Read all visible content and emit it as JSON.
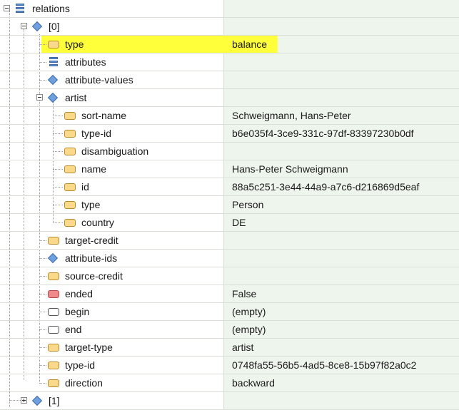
{
  "tree": {
    "rows": [
      {
        "label": "relations",
        "value": ""
      },
      {
        "label": "[0]",
        "value": ""
      },
      {
        "label": "type",
        "value": "balance"
      },
      {
        "label": "attributes",
        "value": ""
      },
      {
        "label": "attribute-values",
        "value": ""
      },
      {
        "label": "artist",
        "value": ""
      },
      {
        "label": "sort-name",
        "value": "Schweigmann, Hans-Peter"
      },
      {
        "label": "type-id",
        "value": "b6e035f4-3ce9-331c-97df-83397230b0df"
      },
      {
        "label": "disambiguation",
        "value": ""
      },
      {
        "label": "name",
        "value": "Hans-Peter Schweigmann"
      },
      {
        "label": "id",
        "value": "88a5c251-3e44-44a9-a7c6-d216869d5eaf"
      },
      {
        "label": "type",
        "value": "Person"
      },
      {
        "label": "country",
        "value": "DE"
      },
      {
        "label": "target-credit",
        "value": ""
      },
      {
        "label": "attribute-ids",
        "value": ""
      },
      {
        "label": "source-credit",
        "value": ""
      },
      {
        "label": "ended",
        "value": "False"
      },
      {
        "label": "begin",
        "value": "(empty)"
      },
      {
        "label": "end",
        "value": "(empty)"
      },
      {
        "label": "target-type",
        "value": "artist"
      },
      {
        "label": "type-id",
        "value": "0748fa55-56b5-4ad5-8ce8-15b97f82a0c2"
      },
      {
        "label": "direction",
        "value": "backward"
      },
      {
        "label": "[1]",
        "value": ""
      }
    ]
  },
  "icons": {
    "array": "array-icon",
    "object": "object-icon",
    "field": "field-icon",
    "bool": "boolean-icon",
    "null": "null-icon"
  },
  "colors": {
    "highlight": "#ffff3a",
    "value_column": "#eef5ec",
    "field_icon": "#fbd98a",
    "object_icon": "#6fa0de",
    "bool_icon": "#f08a8a"
  }
}
